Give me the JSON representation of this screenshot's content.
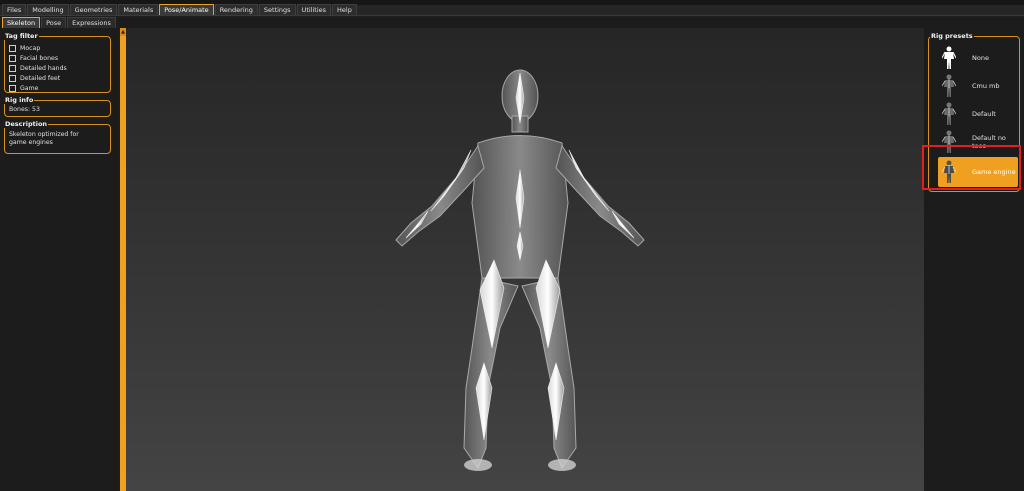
{
  "menubar": {
    "tabs": [
      "Files",
      "Modelling",
      "Geometries",
      "Materials",
      "Pose/Animate",
      "Rendering",
      "Settings",
      "Utilities",
      "Help"
    ],
    "active": "Pose/Animate"
  },
  "subtabs": {
    "tabs": [
      "Skeleton",
      "Pose",
      "Expressions"
    ],
    "active": "Skeleton"
  },
  "tag_filter": {
    "title": "Tag filter",
    "items": [
      "Mocap",
      "Facial bones",
      "Detailed hands",
      "Detailed feet",
      "Game"
    ]
  },
  "rig_info": {
    "title": "Rig info",
    "bones": "Bones: 53"
  },
  "description": {
    "title": "Description",
    "text": "Skeleton optimized for game engines"
  },
  "rig_presets": {
    "title": "Rig presets",
    "items": [
      {
        "label": "None",
        "icon": "figure-white-icon"
      },
      {
        "label": "Cmu mb",
        "icon": "skeleton-thumb-icon"
      },
      {
        "label": "Default",
        "icon": "skeleton-thumb-icon"
      },
      {
        "label": "Default no toes",
        "icon": "skeleton-thumb-icon"
      },
      {
        "label": "Game engine",
        "icon": "skeleton-thumb-icon"
      }
    ],
    "selected": "Game engine"
  },
  "colors": {
    "accent": "#f0a020",
    "highlight_box": "#e02020",
    "panel_bg": "#1c1c1c"
  }
}
